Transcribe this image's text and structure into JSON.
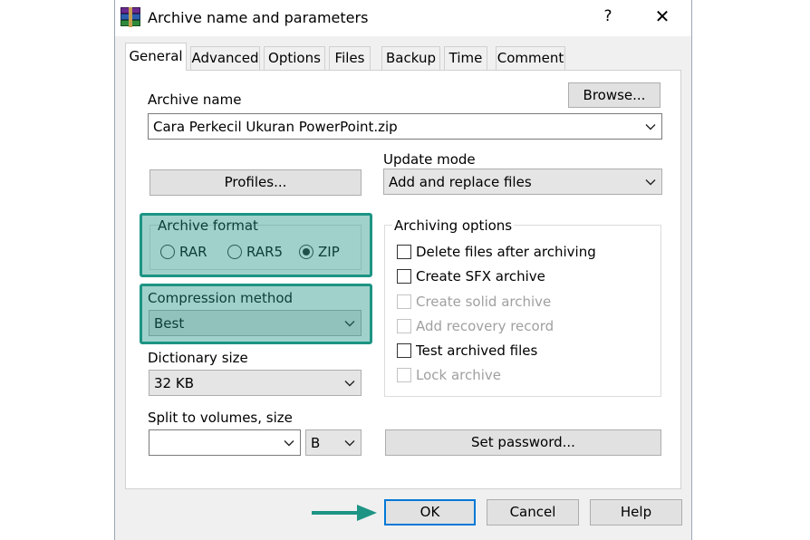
{
  "window": {
    "title": "Archive name and parameters",
    "help_glyph": "?",
    "close_glyph": "✕"
  },
  "tabs": [
    {
      "label": "General",
      "active": true
    },
    {
      "label": "Advanced"
    },
    {
      "label": "Options"
    },
    {
      "label": "Files"
    },
    {
      "label": "Backup"
    },
    {
      "label": "Time"
    },
    {
      "label": "Comment"
    }
  ],
  "archive_name": {
    "label": "Archive name",
    "value": "Cara Perkecil Ukuran PowerPoint.zip",
    "browse_label": "Browse..."
  },
  "update_mode": {
    "label": "Update mode",
    "value": "Add and replace files"
  },
  "profiles_label": "Profiles...",
  "archive_format": {
    "title": "Archive format",
    "options": [
      {
        "label": "RAR"
      },
      {
        "label": "RAR5"
      },
      {
        "label": "ZIP",
        "selected": true
      }
    ]
  },
  "compression_method": {
    "label": "Compression method",
    "value": "Best"
  },
  "dictionary_size": {
    "label": "Dictionary size",
    "value": "32 KB"
  },
  "split_volumes": {
    "label": "Split to volumes, size",
    "value": "",
    "unit": "B"
  },
  "archiving_options": {
    "title": "Archiving options",
    "items": [
      {
        "label": "Delete files after archiving",
        "enabled": true,
        "checked": false
      },
      {
        "label": "Create SFX archive",
        "enabled": true,
        "checked": false
      },
      {
        "label": "Create solid archive",
        "enabled": false,
        "checked": false
      },
      {
        "label": "Add recovery record",
        "enabled": false,
        "checked": false
      },
      {
        "label": "Test archived files",
        "enabled": true,
        "checked": false
      },
      {
        "label": "Lock archive",
        "enabled": false,
        "checked": false
      }
    ]
  },
  "set_password_label": "Set password...",
  "footer": {
    "ok_label": "OK",
    "cancel_label": "Cancel",
    "help_label": "Help"
  },
  "colors": {
    "highlight": "#1d9484",
    "button_focus": "#0078d7"
  }
}
